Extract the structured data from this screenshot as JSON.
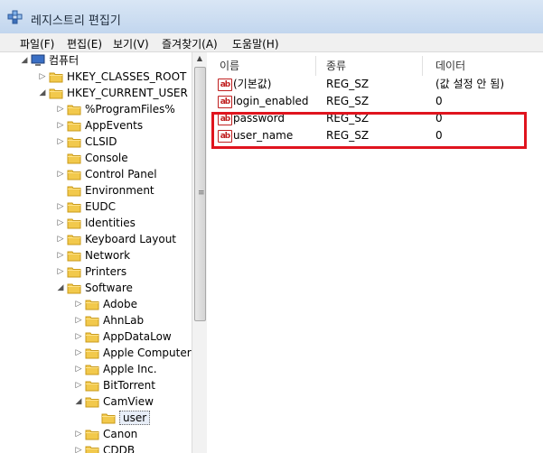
{
  "window": {
    "title": "레지스트리 편집기",
    "app_icon": "registry-editor-icon"
  },
  "menu": [
    "파일(F)",
    "편집(E)",
    "보기(V)",
    "즐겨찾기(A)",
    "도움말(H)"
  ],
  "tree": [
    {
      "label": "컴퓨터",
      "expander": "expanded",
      "icon": "computer-icon"
    },
    {
      "label": "HKEY_CLASSES_ROOT",
      "expander": "collapsed",
      "icon": "folder-icon"
    },
    {
      "label": "HKEY_CURRENT_USER",
      "expander": "expanded",
      "icon": "folder-icon"
    },
    {
      "label": "%ProgramFiles%",
      "expander": "collapsed",
      "icon": "folder-icon"
    },
    {
      "label": "AppEvents",
      "expander": "collapsed",
      "icon": "folder-icon"
    },
    {
      "label": "CLSID",
      "expander": "collapsed",
      "icon": "folder-icon"
    },
    {
      "label": "Console",
      "expander": "none",
      "icon": "folder-icon"
    },
    {
      "label": "Control Panel",
      "expander": "collapsed",
      "icon": "folder-icon"
    },
    {
      "label": "Environment",
      "expander": "none",
      "icon": "folder-icon"
    },
    {
      "label": "EUDC",
      "expander": "collapsed",
      "icon": "folder-icon"
    },
    {
      "label": "Identities",
      "expander": "collapsed",
      "icon": "folder-icon"
    },
    {
      "label": "Keyboard Layout",
      "expander": "collapsed",
      "icon": "folder-icon"
    },
    {
      "label": "Network",
      "expander": "collapsed",
      "icon": "folder-icon"
    },
    {
      "label": "Printers",
      "expander": "collapsed",
      "icon": "folder-icon"
    },
    {
      "label": "Software",
      "expander": "expanded",
      "icon": "folder-icon"
    },
    {
      "label": "Adobe",
      "expander": "collapsed",
      "icon": "folder-icon"
    },
    {
      "label": "AhnLab",
      "expander": "collapsed",
      "icon": "folder-icon"
    },
    {
      "label": "AppDataLow",
      "expander": "collapsed",
      "icon": "folder-icon"
    },
    {
      "label": "Apple Computer,",
      "expander": "collapsed",
      "icon": "folder-icon"
    },
    {
      "label": "Apple Inc.",
      "expander": "collapsed",
      "icon": "folder-icon"
    },
    {
      "label": "BitTorrent",
      "expander": "collapsed",
      "icon": "folder-icon"
    },
    {
      "label": "CamView",
      "expander": "expanded",
      "icon": "folder-icon"
    },
    {
      "label": "user",
      "expander": "none",
      "icon": "folder-icon",
      "selected": true
    },
    {
      "label": "Canon",
      "expander": "collapsed",
      "icon": "folder-icon"
    },
    {
      "label": "CDDB",
      "expander": "collapsed",
      "icon": "folder-icon"
    }
  ],
  "columns": [
    "이름",
    "종류",
    "데이터"
  ],
  "values": [
    {
      "name": "(기본값)",
      "type": "REG_SZ",
      "data": "(값 설정 안 됨)",
      "icon": "string-value-icon"
    },
    {
      "name": "login_enabled",
      "type": "REG_SZ",
      "data": "0",
      "icon": "string-value-icon"
    },
    {
      "name": "password",
      "type": "REG_SZ",
      "data": "0",
      "icon": "string-value-icon"
    },
    {
      "name": "user_name",
      "type": "REG_SZ",
      "data": "0",
      "icon": "string-value-icon"
    }
  ],
  "value_icon_text": "ab",
  "colors": {
    "highlight_border": "#e0141e",
    "folder": "#f2c94c",
    "ab_icon": "#c02020"
  }
}
